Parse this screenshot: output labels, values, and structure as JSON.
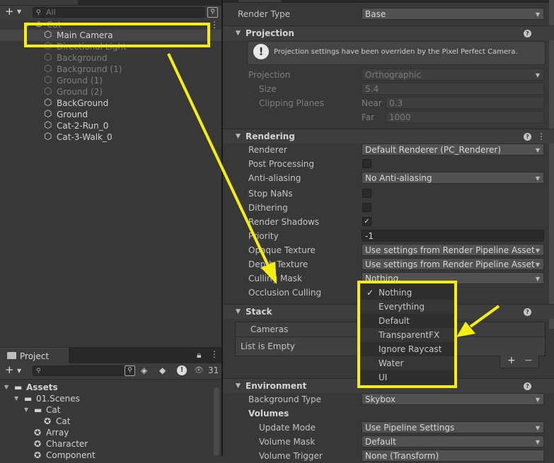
{
  "hierarchy": {
    "search_placeholder": "All",
    "root": "Cat",
    "items": [
      {
        "label": "Main Camera",
        "state": "selected"
      },
      {
        "label": "Directional Light",
        "state": "dim"
      },
      {
        "label": "Background",
        "state": "dim"
      },
      {
        "label": "Background (1)",
        "state": "dim"
      },
      {
        "label": "Ground (1)",
        "state": "dim"
      },
      {
        "label": "Ground (2)",
        "state": "dim"
      },
      {
        "label": "BackGround",
        "state": "normal"
      },
      {
        "label": "Ground",
        "state": "normal"
      },
      {
        "label": "Cat-2-Run_0",
        "state": "normal"
      },
      {
        "label": "Cat-3-Walk_0",
        "state": "normal"
      }
    ]
  },
  "project": {
    "tab_label": "Project",
    "hidden_count": "31",
    "tree": [
      {
        "label": "Assets",
        "level": 0
      },
      {
        "label": "01.Scenes",
        "level": 1
      },
      {
        "label": "Cat",
        "level": 2
      },
      {
        "label": "Cat",
        "level": 3
      },
      {
        "label": "Array",
        "level": 2
      },
      {
        "label": "Character",
        "level": 2
      },
      {
        "label": "Component",
        "level": 2
      }
    ]
  },
  "inspector": {
    "render_type": {
      "label": "Render Type",
      "value": "Base"
    },
    "projection_section": {
      "title": "Projection",
      "info": "Projection settings have been overriden by the Pixel Perfect Camera.",
      "projection_label": "Projection",
      "projection_value": "Orthographic",
      "size_label": "Size",
      "size_value": "5.4",
      "clipping_label": "Clipping Planes",
      "near_label": "Near",
      "near_value": "0.3",
      "far_label": "Far",
      "far_value": "1000"
    },
    "rendering_section": {
      "title": "Rendering",
      "renderer_label": "Renderer",
      "renderer_value": "Default Renderer (PC_Renderer)",
      "post_label": "Post Processing",
      "aa_label": "Anti-aliasing",
      "aa_value": "No Anti-aliasing",
      "nan_label": "Stop NaNs",
      "dither_label": "Dithering",
      "shadows_label": "Render Shadows",
      "priority_label": "Priority",
      "priority_value": "-1",
      "opaque_label": "Opaque Texture",
      "opaque_value": "Use settings from Render Pipeline Asset",
      "depth_label": "Depth Texture",
      "depth_value": "Use settings from Render Pipeline Asset",
      "culling_label": "Culling Mask",
      "culling_value": "Nothing",
      "occlusion_label": "Occlusion Culling"
    },
    "stack_section": {
      "title": "Stack",
      "cameras_label": "Cameras",
      "empty_label": "List is Empty",
      "add_symbol": "+",
      "remove_symbol": "−"
    },
    "environment_section": {
      "title": "Environment",
      "bg_label": "Background Type",
      "bg_value": "Skybox",
      "volumes_label": "Volumes",
      "update_label": "Update Mode",
      "update_value": "Use Pipeline Settings",
      "mask_label": "Volume Mask",
      "mask_value": "Default",
      "trigger_label": "Volume Trigger",
      "trigger_value": "None (Transform)"
    }
  },
  "culling_popup": {
    "options": [
      {
        "label": "Nothing",
        "checked": true
      },
      {
        "label": "Everything",
        "checked": false
      },
      {
        "label": "Default",
        "checked": false
      },
      {
        "label": "TransparentFX",
        "checked": false
      },
      {
        "label": "Ignore Raycast",
        "checked": false
      },
      {
        "label": "Water",
        "checked": false
      },
      {
        "label": "UI",
        "checked": false
      }
    ],
    "check_mark": "✓"
  },
  "annotation": {
    "color": "#f5ee0e"
  },
  "colors": {
    "panel": "#383838",
    "header": "#3e3e3e",
    "field": "#515151"
  }
}
